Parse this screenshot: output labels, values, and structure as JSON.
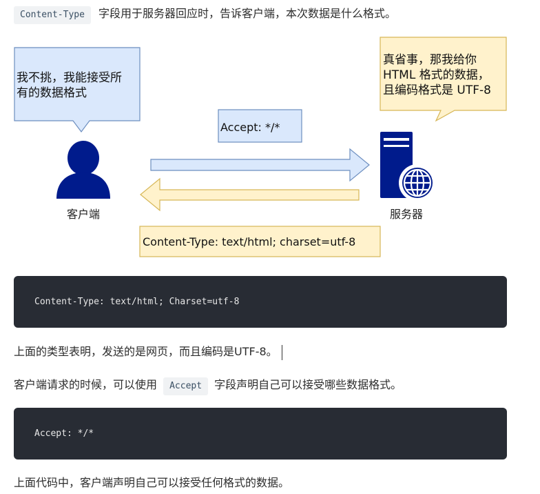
{
  "intro": {
    "code": "Content-Type",
    "text": "字段用于服务器回应时，告诉客户端，本次数据是什么格式。"
  },
  "diagram": {
    "client_bubble_line1": "我不挑，我能接受所",
    "client_bubble_line2": "有的数据格式",
    "server_bubble_line1": "真省事，那我给你",
    "server_bubble_line2": "HTML 格式的数据，",
    "server_bubble_line3": "且编码格式是 UTF-8",
    "accept_box": "Accept: */*",
    "content_type_box": "Content-Type: text/html; charset=utf-8",
    "client_label": "客户端",
    "server_label": "服务器",
    "colors": {
      "blue_fill": "#dae8fc",
      "blue_stroke": "#6c8ebf",
      "yellow_fill": "#fff2cc",
      "yellow_stroke": "#d6b656",
      "icon_navy": "#001b8c"
    },
    "icons": [
      "user-icon",
      "server-icon",
      "globe-icon"
    ]
  },
  "code_block_1": "Content-Type: text/html; Charset=utf-8",
  "para_2": "上面的类型表明，发送的是网页，而且编码是UTF-8。",
  "para_3": {
    "before": "客户端请求的时候，可以使用",
    "code": "Accept",
    "after": "字段声明自己可以接受哪些数据格式。"
  },
  "code_block_2": "Accept: */*",
  "para_4": "上面代码中，客户端声明自己可以接受任何格式的数据。"
}
